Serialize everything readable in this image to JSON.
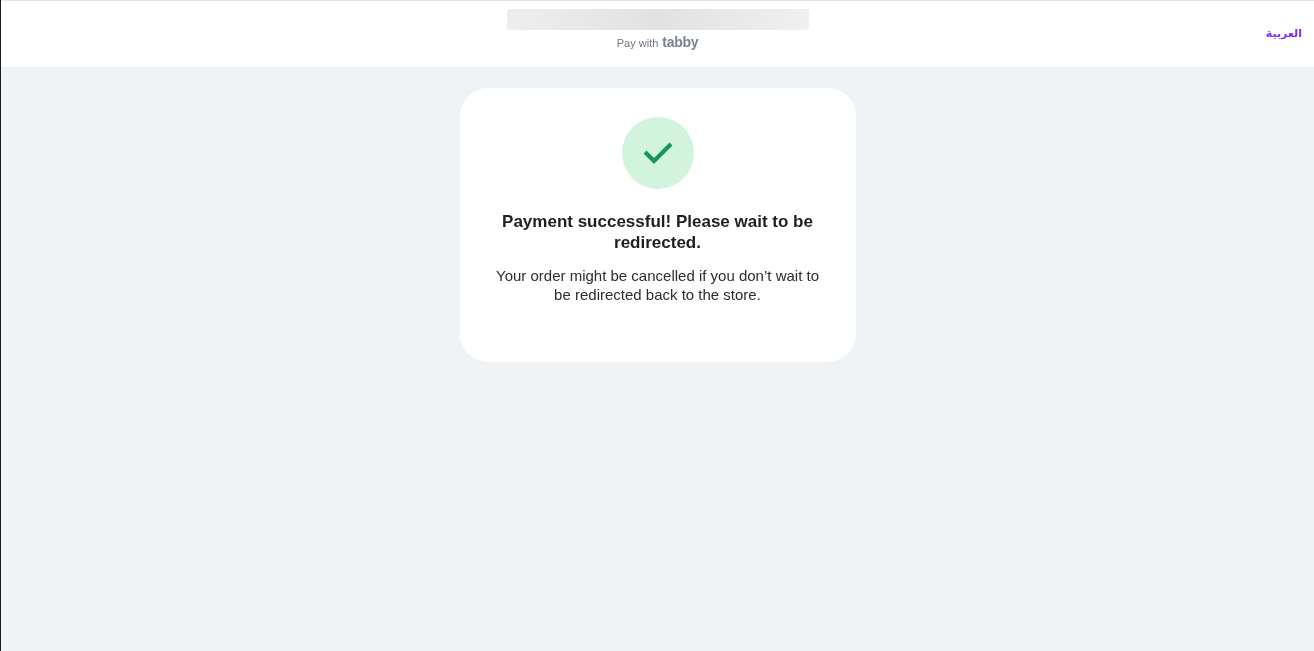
{
  "header": {
    "pay_with": "Pay with",
    "brand": "tabby",
    "language_link": "العربية"
  },
  "status": {
    "kind": "success",
    "title": "Payment successful! Please wait to be redirected.",
    "message": "Your order might be cancelled if you don’t wait to be redirected back to the store."
  }
}
